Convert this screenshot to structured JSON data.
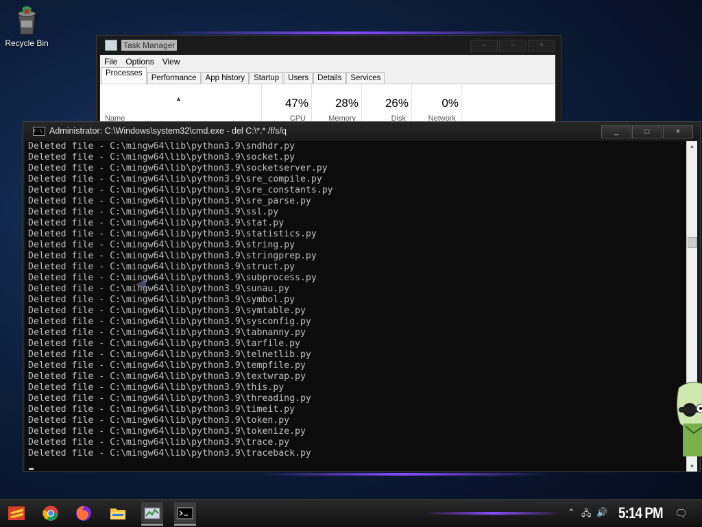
{
  "desktop": {
    "recycle_bin_label": "Recycle Bin"
  },
  "task_manager": {
    "title": "Task Manager",
    "menu": [
      "File",
      "Options",
      "View"
    ],
    "tabs": [
      "Processes",
      "Performance",
      "App history",
      "Startup",
      "Users",
      "Details",
      "Services"
    ],
    "active_tab": "Processes",
    "columns": {
      "name_label": "Name",
      "cpu": {
        "value": "47%",
        "label": "CPU"
      },
      "memory": {
        "value": "28%",
        "label": "Memory"
      },
      "disk": {
        "value": "26%",
        "label": "Disk"
      },
      "network": {
        "value": "0%",
        "label": "Network"
      }
    },
    "controls": {
      "minimize": "–",
      "maximize": "▫",
      "close": "×"
    }
  },
  "cmd": {
    "title": "Administrator: C:\\Windows\\system32\\cmd.exe - del  C:\\*.* /f/s/q",
    "controls": {
      "minimize": "_",
      "maximize": "□",
      "close": "×"
    },
    "lines": [
      "Deleted file - C:\\mingw64\\lib\\python3.9\\sndhdr.py",
      "Deleted file - C:\\mingw64\\lib\\python3.9\\socket.py",
      "Deleted file - C:\\mingw64\\lib\\python3.9\\socketserver.py",
      "Deleted file - C:\\mingw64\\lib\\python3.9\\sre_compile.py",
      "Deleted file - C:\\mingw64\\lib\\python3.9\\sre_constants.py",
      "Deleted file - C:\\mingw64\\lib\\python3.9\\sre_parse.py",
      "Deleted file - C:\\mingw64\\lib\\python3.9\\ssl.py",
      "Deleted file - C:\\mingw64\\lib\\python3.9\\stat.py",
      "Deleted file - C:\\mingw64\\lib\\python3.9\\statistics.py",
      "Deleted file - C:\\mingw64\\lib\\python3.9\\string.py",
      "Deleted file - C:\\mingw64\\lib\\python3.9\\stringprep.py",
      "Deleted file - C:\\mingw64\\lib\\python3.9\\struct.py",
      "Deleted file - C:\\mingw64\\lib\\python3.9\\subprocess.py",
      "Deleted file - C:\\mingw64\\lib\\python3.9\\sunau.py",
      "Deleted file - C:\\mingw64\\lib\\python3.9\\symbol.py",
      "Deleted file - C:\\mingw64\\lib\\python3.9\\symtable.py",
      "Deleted file - C:\\mingw64\\lib\\python3.9\\sysconfig.py",
      "Deleted file - C:\\mingw64\\lib\\python3.9\\tabnanny.py",
      "Deleted file - C:\\mingw64\\lib\\python3.9\\tarfile.py",
      "Deleted file - C:\\mingw64\\lib\\python3.9\\telnetlib.py",
      "Deleted file - C:\\mingw64\\lib\\python3.9\\tempfile.py",
      "Deleted file - C:\\mingw64\\lib\\python3.9\\textwrap.py",
      "Deleted file - C:\\mingw64\\lib\\python3.9\\this.py",
      "Deleted file - C:\\mingw64\\lib\\python3.9\\threading.py",
      "Deleted file - C:\\mingw64\\lib\\python3.9\\timeit.py",
      "Deleted file - C:\\mingw64\\lib\\python3.9\\token.py",
      "Deleted file - C:\\mingw64\\lib\\python3.9\\tokenize.py",
      "Deleted file - C:\\mingw64\\lib\\python3.9\\trace.py",
      "Deleted file - C:\\mingw64\\lib\\python3.9\\traceback.py"
    ]
  },
  "taskbar": {
    "time": "5:14 PM",
    "apps": [
      "start-icon",
      "chrome-icon",
      "firefox-icon",
      "file-explorer-icon",
      "task-manager-icon",
      "cmd-icon"
    ]
  },
  "colors": {
    "accent_purple": "#8a4cff",
    "console_text": "#c0c0c0",
    "console_bg": "#0c0c0c"
  }
}
